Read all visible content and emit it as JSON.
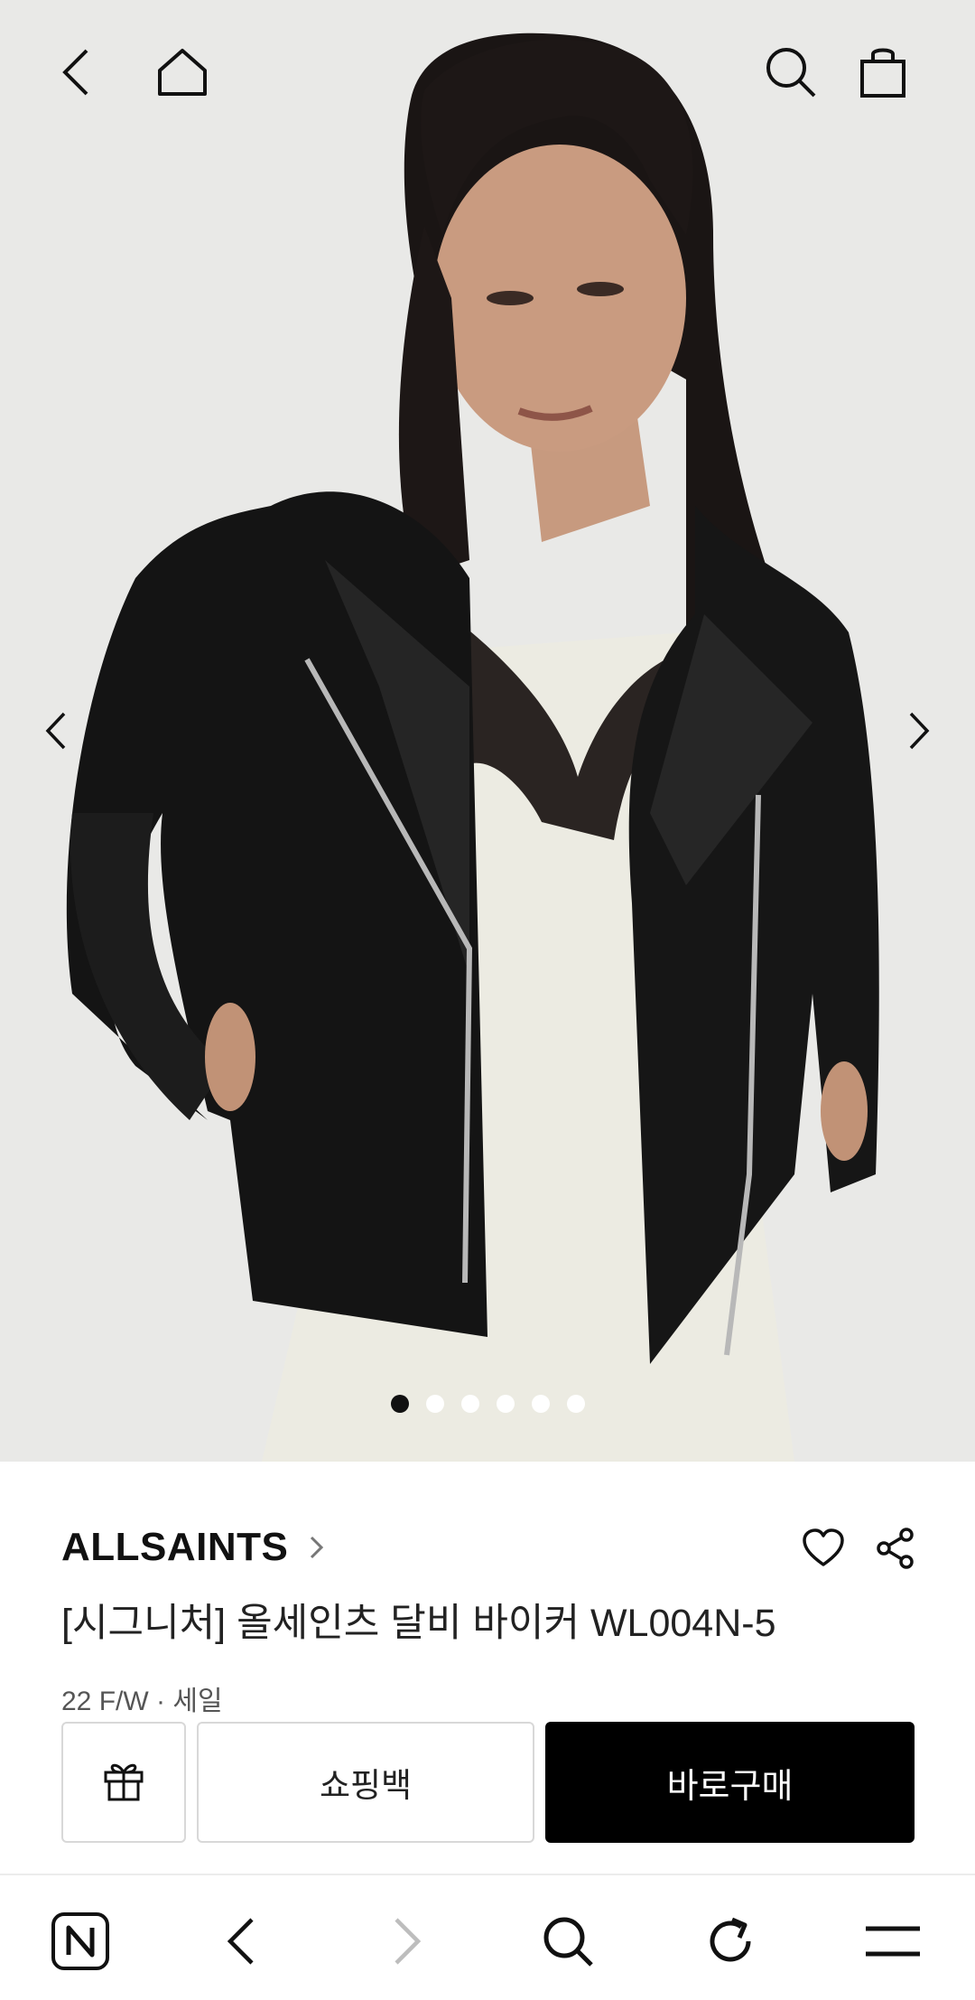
{
  "topbar": {
    "icons": [
      "back-icon",
      "home-icon",
      "search-icon",
      "shopping-bag-icon"
    ]
  },
  "carousel": {
    "total_slides": 6,
    "active_slide": 1
  },
  "product": {
    "brand": "ALLSAINTS",
    "title": "[시그니처] 올세인츠 달비 바이커 WL004N-5",
    "season": "22 F/W · 세일"
  },
  "actions": {
    "gift_icon": "gift-icon",
    "cart_label": "쇼핑백",
    "buy_label": "바로구매"
  },
  "browser_toolbar": {
    "icons": [
      "naver-home-icon",
      "back-icon",
      "forward-icon",
      "search-icon",
      "reload-icon",
      "menu-icon"
    ]
  },
  "colors": {
    "buy_button": "#000000",
    "border": "#d8d8d8",
    "disabled_icon": "#bdbdbd"
  }
}
